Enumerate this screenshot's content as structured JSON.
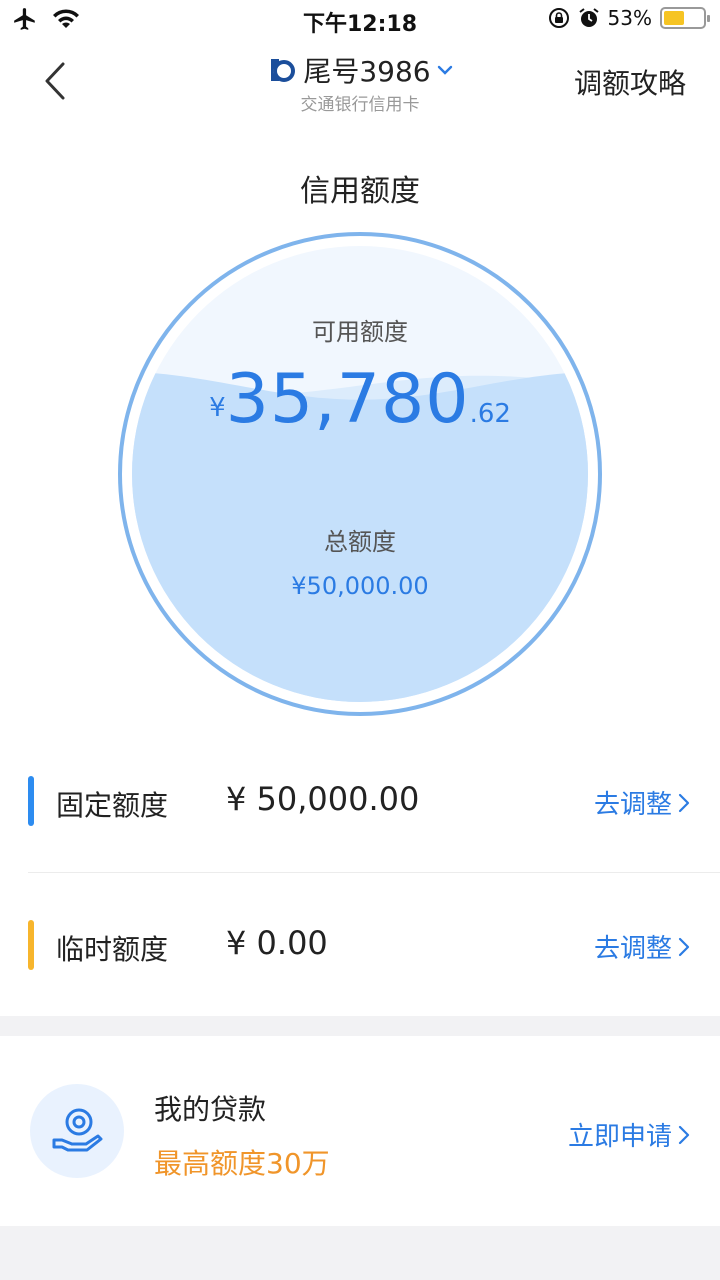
{
  "status_bar": {
    "time": "下午12:18",
    "battery_percent": "53%",
    "battery_level": 0.53,
    "icons": [
      "airplane-icon",
      "wifi-icon",
      "rotation-lock-icon",
      "alarm-icon",
      "battery-icon"
    ]
  },
  "nav": {
    "card_title": "尾号3986",
    "bank_name": "交通银行信用卡",
    "right_link": "调额攻略"
  },
  "section_title": "信用额度",
  "credit_circle": {
    "available_label": "可用额度",
    "available_currency": "¥",
    "available_integer": "35,780",
    "available_decimal": ".62",
    "total_label": "总额度",
    "total_amount": "¥50,000.00",
    "available_ratio": 0.7156
  },
  "quota_rows": [
    {
      "label": "固定额度",
      "value": "¥ 50,000.00",
      "action": "去调整",
      "bar_color": "#2d8cf0"
    },
    {
      "label": "临时额度",
      "value": "¥ 0.00",
      "action": "去调整",
      "bar_color": "#f7b52c"
    }
  ],
  "loan": {
    "title": "我的贷款",
    "subtitle": "最高额度30万",
    "action": "立即申请"
  },
  "colors": {
    "accent": "#2b7be3",
    "orange": "#f0952a",
    "circle_fill": "#c5e0fb",
    "circle_border": "#7fb4ec"
  }
}
